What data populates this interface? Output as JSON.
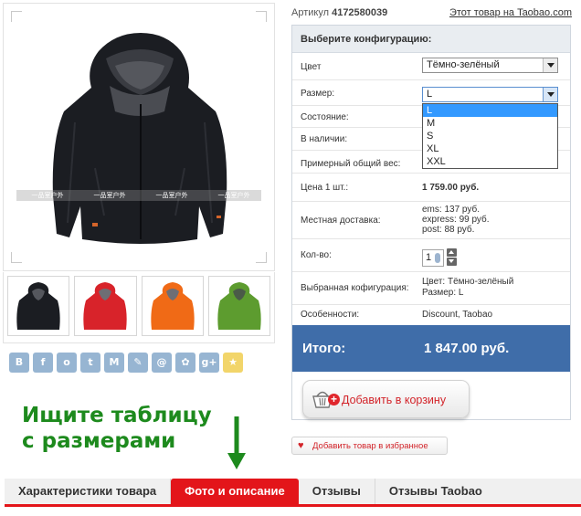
{
  "product": {
    "sku_label": "Артикул",
    "sku_value": "4172580039",
    "taobao_link": "Этот товар на Taobao.com",
    "watermark": "一品室户外"
  },
  "config": {
    "heading": "Выберите конфигурацию:",
    "color_label": "Цвет",
    "color_value": "Тёмно-зелёный",
    "size_label": "Размер:",
    "size_value": "L",
    "size_options": [
      "L",
      "M",
      "S",
      "XL",
      "XXL"
    ],
    "condition_label": "Состояние:",
    "stock_label": "В наличии:",
    "weight_label": "Примерный общий вес:",
    "price_label": "Цена 1 шт.:",
    "price_value": "1 759.00 руб.",
    "delivery_label": "Местная доставка:",
    "delivery_ems": "ems: 137 руб.",
    "delivery_express": "express: 99 руб.",
    "delivery_post": "post: 88 руб.",
    "qty_label": "Кол-во:",
    "qty_value": "1",
    "selected_label": "Выбранная кофигурация:",
    "selected_color": "Цвет: Тёмно-зелёный",
    "selected_size": "Размер: L",
    "features_label": "Особенности:",
    "features_value": "Discount, Taobao",
    "total_label": "Итого:",
    "total_value": "1 847.00 руб."
  },
  "actions": {
    "add_to_cart": "Добавить в корзину",
    "add_to_favorites": "Добавить товар в избранное"
  },
  "share": {
    "icons": [
      "vk-icon",
      "facebook-icon",
      "odnoklassniki-icon",
      "twitter-icon",
      "moimir-icon",
      "livejournal-icon",
      "mailru-icon",
      "ya-icon",
      "google-plus-icon",
      "bookmark-star-icon"
    ],
    "glyphs": [
      "B",
      "f",
      "о",
      "t",
      "М",
      "✎",
      "@",
      "✿",
      "g+",
      "★"
    ]
  },
  "hint": {
    "line1": "Ищите таблицу",
    "line2": "с размерами"
  },
  "tabs": {
    "items": [
      "Характеристики товара",
      "Фото и описание",
      "Отзывы",
      "Отзывы Taobao"
    ],
    "active_index": 1
  },
  "colors": {
    "accent_red": "#e3151a",
    "total_blue": "#3f6da9",
    "hint_green": "#1d8a1d",
    "jacket_colors": [
      "#1b1d22",
      "#d8232a",
      "#f06a16",
      "#5d9c2f"
    ]
  }
}
